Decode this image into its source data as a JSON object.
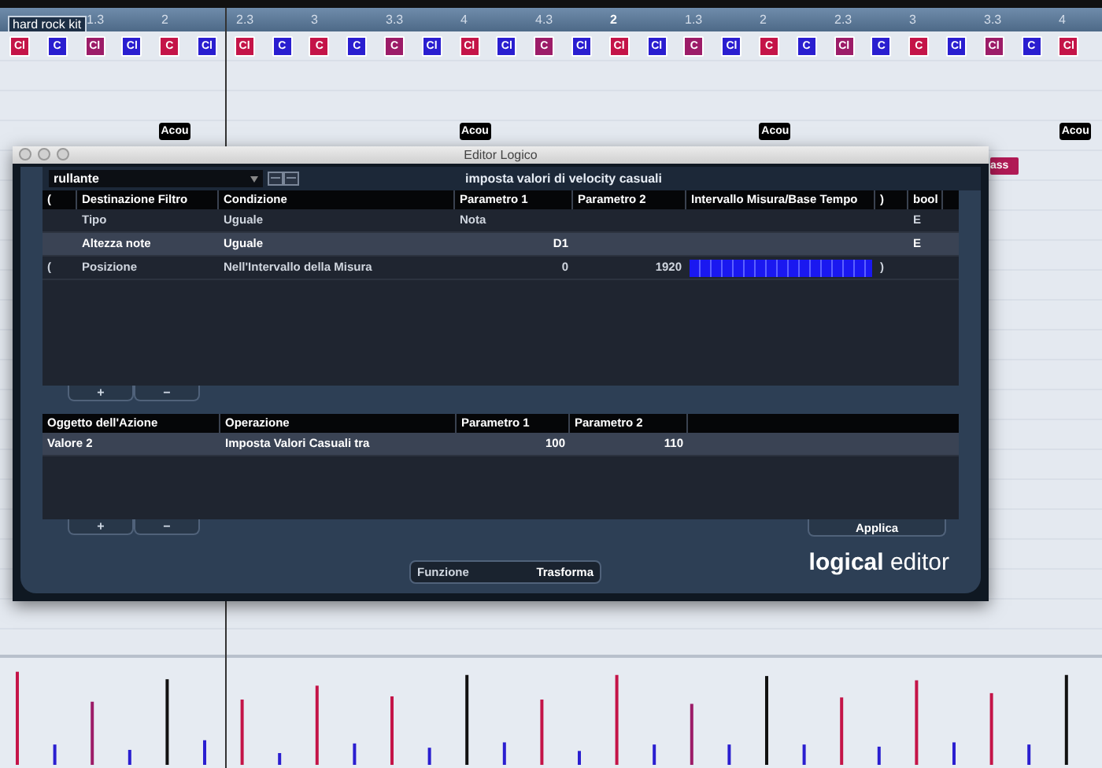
{
  "ruler": {
    "track_name": "hard rock kit",
    "marks": [
      {
        "label": "1.3",
        "bar_start": false
      },
      {
        "label": "2",
        "bar_start": false
      },
      {
        "label": "2.3",
        "bar_start": false
      },
      {
        "label": "3",
        "bar_start": false
      },
      {
        "label": "3.3",
        "bar_start": false
      },
      {
        "label": "4",
        "bar_start": false
      },
      {
        "label": "4.3",
        "bar_start": false
      },
      {
        "label": "2",
        "bar_start": true
      },
      {
        "label": "1.3",
        "bar_start": false
      },
      {
        "label": "2",
        "bar_start": false
      },
      {
        "label": "2.3",
        "bar_start": false
      },
      {
        "label": "3",
        "bar_start": false
      },
      {
        "label": "3.3",
        "bar_start": false
      },
      {
        "label": "4",
        "bar_start": false
      }
    ]
  },
  "notes": [
    {
      "label": "Cl",
      "color": "#c41448"
    },
    {
      "label": "C",
      "color": "#2a1ed0"
    },
    {
      "label": "Cl",
      "color": "#9c1c68"
    },
    {
      "label": "Cl",
      "color": "#2a1ed0"
    },
    {
      "label": "C",
      "color": "#c41448"
    },
    {
      "label": "Cl",
      "color": "#2a1ed0"
    },
    {
      "label": "Cl",
      "color": "#c41448"
    },
    {
      "label": "C",
      "color": "#2a1ed0"
    },
    {
      "label": "C",
      "color": "#c41448"
    },
    {
      "label": "C",
      "color": "#2a1ed0"
    },
    {
      "label": "C",
      "color": "#9c1c68"
    },
    {
      "label": "Cl",
      "color": "#2a1ed0"
    },
    {
      "label": "Cl",
      "color": "#c41448"
    },
    {
      "label": "Cl",
      "color": "#2a1ed0"
    },
    {
      "label": "C",
      "color": "#9c1c68"
    },
    {
      "label": "Cl",
      "color": "#2a1ed0"
    },
    {
      "label": "Cl",
      "color": "#c41448"
    },
    {
      "label": "Cl",
      "color": "#2a1ed0"
    },
    {
      "label": "C",
      "color": "#9c1c68"
    },
    {
      "label": "Cl",
      "color": "#2a1ed0"
    },
    {
      "label": "C",
      "color": "#c41448"
    },
    {
      "label": "C",
      "color": "#2a1ed0"
    },
    {
      "label": "Cl",
      "color": "#9c1c68"
    },
    {
      "label": "C",
      "color": "#2a1ed0"
    },
    {
      "label": "C",
      "color": "#c41448"
    },
    {
      "label": "Cl",
      "color": "#2a1ed0"
    },
    {
      "label": "Cl",
      "color": "#9c1c68"
    },
    {
      "label": "C",
      "color": "#2a1ed0"
    },
    {
      "label": "Cl",
      "color": "#c41448"
    }
  ],
  "kick_notes": [
    "Acou",
    "Acou",
    "Acou",
    "Acou"
  ],
  "side_note": "ass",
  "editor": {
    "title": "Editor Logico",
    "preset": "rullante",
    "preset_title": "imposta valori di velocity casuali",
    "filter_columns": [
      "(",
      "Destinazione Filtro",
      "Condizione",
      "Parametro 1",
      "Parametro 2",
      "Intervallo Misura/Base Tempo",
      ")",
      "bool"
    ],
    "filter_rows": [
      {
        "target": "Tipo",
        "condition": "Uguale",
        "param1": "Nota",
        "range_bar": false,
        "bool": "E",
        "selected": false
      },
      {
        "target": "Altezza note",
        "condition": "Uguale",
        "param1": "D1",
        "range_bar": false,
        "bool": "E",
        "selected": true
      },
      {
        "open": "(",
        "target": "Posizione",
        "condition": "Nell'Intervallo della Misura",
        "param1": "0",
        "param2": "1920",
        "range_bar": true,
        "close": ")",
        "selected": false
      }
    ],
    "add_label": "+",
    "remove_label": "−",
    "action_columns": [
      "Oggetto dell'Azione",
      "Operazione",
      "Parametro 1",
      "Parametro 2"
    ],
    "action_rows": [
      {
        "target": "Valore 2",
        "operation": "Imposta Valori Casuali tra",
        "param1": "100",
        "param2": "110",
        "selected": true
      }
    ],
    "apply": "Applica",
    "function_label": "Funzione",
    "function_value": "Trasforma",
    "logo_bold": "logical",
    "logo_light": "editor"
  }
}
